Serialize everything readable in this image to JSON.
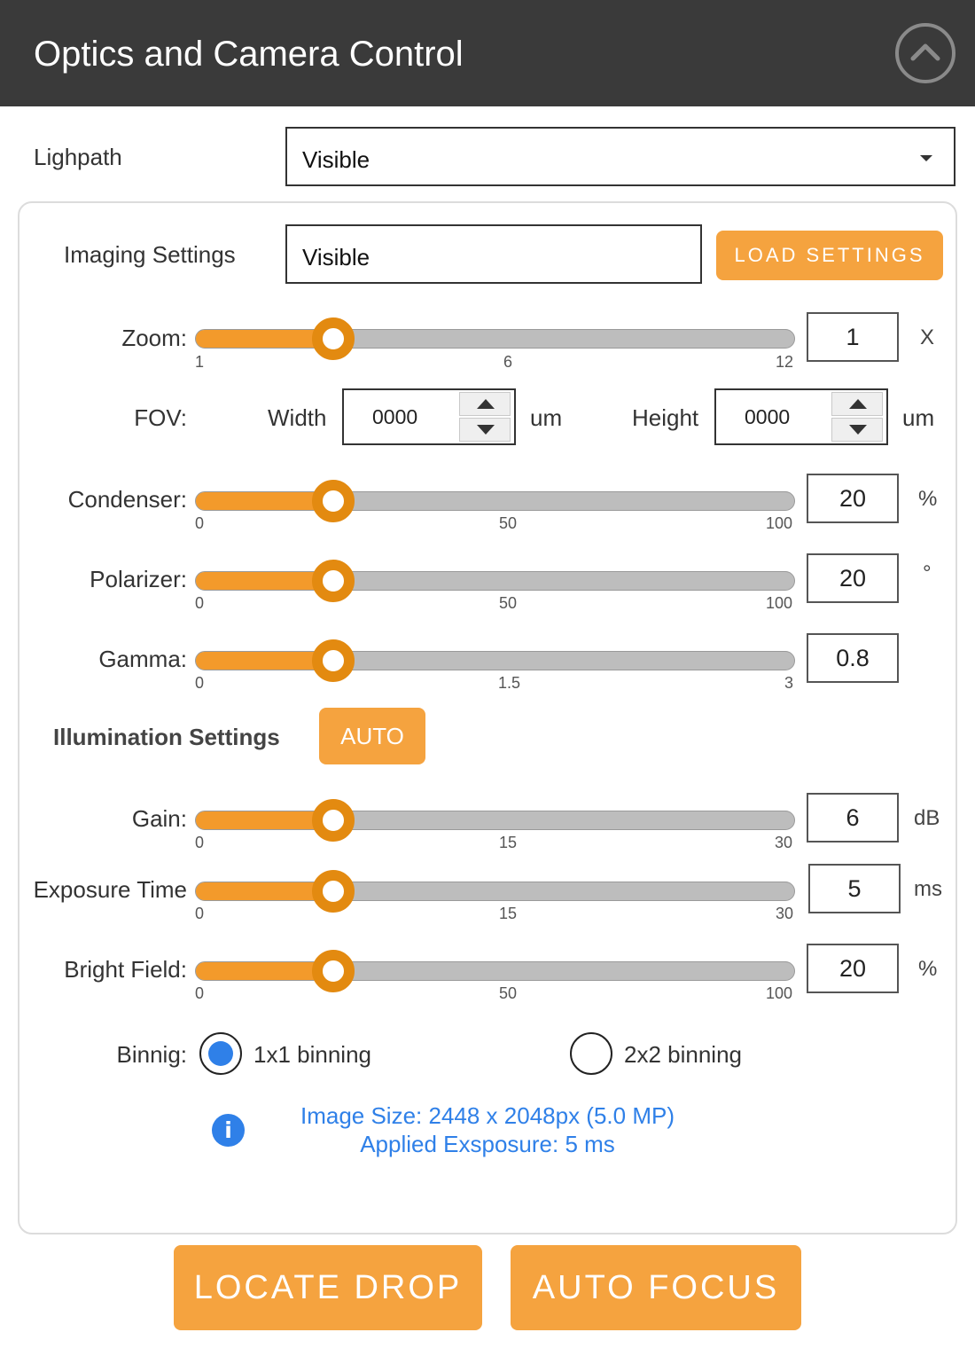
{
  "header": {
    "title": "Optics and Camera Control",
    "collapse_icon": "chevron-up-circle-icon"
  },
  "lightpath": {
    "label": "Lighpath",
    "selected": "Visible"
  },
  "imaging": {
    "label": "Imaging Settings",
    "value": "Visible",
    "load_button": "LOAD SETTINGS"
  },
  "zoom": {
    "label": "Zoom:",
    "ticks": [
      "1",
      "6",
      "12"
    ],
    "value": "1",
    "unit": "X",
    "fraction": 0.23
  },
  "fov": {
    "label": "FOV:",
    "width_label": "Width",
    "width_value": "0000",
    "width_unit": "um",
    "height_label": "Height",
    "height_value": "0000",
    "height_unit": "um"
  },
  "condenser": {
    "label": "Condenser:",
    "ticks": [
      "0",
      "50",
      "100"
    ],
    "value": "20",
    "unit": "%",
    "fraction": 0.23
  },
  "polarizer": {
    "label": "Polarizer:",
    "ticks": [
      "0",
      "50",
      "100"
    ],
    "value": "20",
    "unit": "°",
    "fraction": 0.23
  },
  "gamma": {
    "label": "Gamma:",
    "ticks": [
      "0",
      "1.5",
      "3"
    ],
    "value": "0.8",
    "unit": "",
    "fraction": 0.23
  },
  "illumination": {
    "label": "Illumination Settings",
    "auto_button": "AUTO"
  },
  "gain": {
    "label": "Gain:",
    "ticks": [
      "0",
      "15",
      "30"
    ],
    "value": "6",
    "unit": "dB",
    "fraction": 0.23
  },
  "exposure": {
    "label": "Exposure Time",
    "ticks": [
      "0",
      "15",
      "30"
    ],
    "value": "5",
    "unit": "ms",
    "fraction": 0.23
  },
  "brightfield": {
    "label": "Bright Field:",
    "ticks": [
      "0",
      "50",
      "100"
    ],
    "value": "20",
    "unit": "%",
    "fraction": 0.23
  },
  "binning": {
    "label": "Binnig:",
    "options": [
      {
        "label": "1x1 binning",
        "selected": true
      },
      {
        "label": "2x2 binning",
        "selected": false
      }
    ]
  },
  "info": {
    "icon": "info-icon",
    "line1": "Image Size: 2448 x 2048px (5.0 MP)",
    "line2": "Applied Exsposure: 5 ms"
  },
  "actions": {
    "locate": "LOCATE DROP",
    "autofocus": "AUTO FOCUS"
  },
  "colors": {
    "accent": "#f5a33f",
    "slider_fill": "#f39a2b",
    "thumb": "#e38a10",
    "info": "#2f80e8",
    "header_bg": "#3a3a3a"
  }
}
